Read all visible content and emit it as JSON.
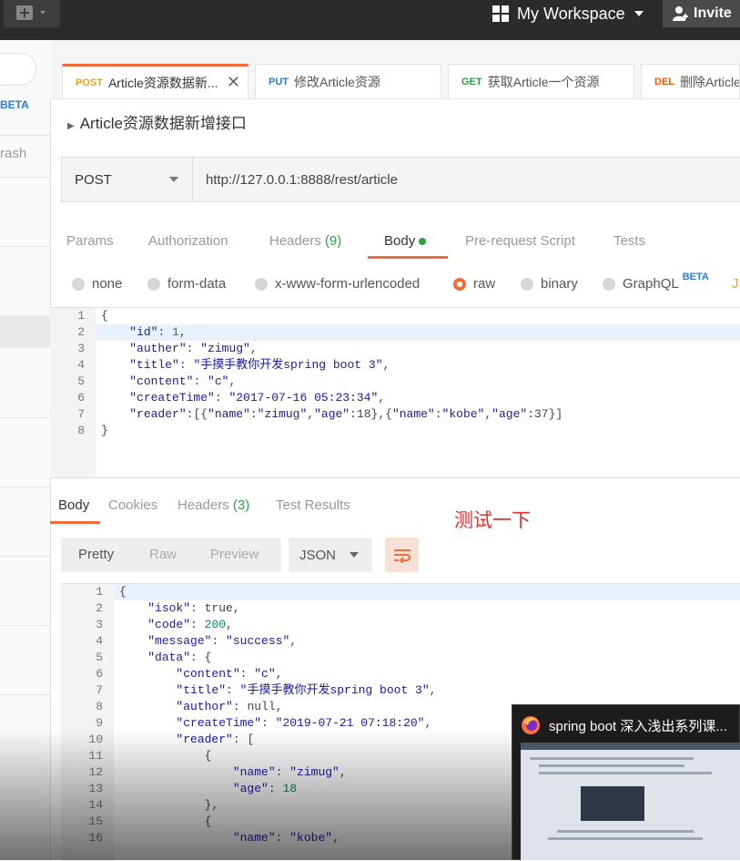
{
  "topbar": {
    "workspace": "My Workspace",
    "invite": "Invite"
  },
  "sidebar": {
    "beta": "BETA",
    "trash": "rash"
  },
  "tabs": [
    {
      "method": "POST",
      "label": "Article资源数据新...",
      "method_color": "#e8a417"
    },
    {
      "method": "PUT",
      "label": "修改Article资源",
      "method_color": "#2a7bd8"
    },
    {
      "method": "GET",
      "label": "获取Article一个资源",
      "method_color": "#2f9e44"
    },
    {
      "method": "DEL",
      "label": "删除Article",
      "method_color": "#e8590c"
    }
  ],
  "request": {
    "name": "Article资源数据新增接口",
    "method": "POST",
    "url": "http://127.0.0.1:8888/rest/article"
  },
  "request_tabs": {
    "params": "Params",
    "authorization": "Authorization",
    "headers": "Headers",
    "headers_count": "(9)",
    "body": "Body",
    "prerequest": "Pre-request Script",
    "tests": "Tests"
  },
  "body_types": {
    "none": "none",
    "form_data": "form-data",
    "urlencoded": "x-www-form-urlencoded",
    "raw": "raw",
    "binary": "binary",
    "graphql": "GraphQL",
    "graphql_beta": "BETA",
    "json": "JS"
  },
  "request_body": {
    "line_numbers": [
      "1",
      "2",
      "3",
      "4",
      "5",
      "6",
      "7",
      "8"
    ],
    "lines": [
      "{",
      "    \"id\": 1,",
      "    \"auther\": \"zimug\",",
      "    \"title\": \"手摸手教你开发spring boot 3\",",
      "    \"content\": \"c\",",
      "    \"createTime\": \"2017-07-16 05:23:34\",",
      "    \"reader\":[{\"name\":\"zimug\",\"age\":18},{\"name\":\"kobe\",\"age\":37}]",
      "}"
    ]
  },
  "response_tabs": {
    "body": "Body",
    "cookies": "Cookies",
    "headers": "Headers",
    "headers_count": "(3)",
    "test_results": "Test Results"
  },
  "annotation": "测试一下",
  "response_format": {
    "pretty": "Pretty",
    "raw": "Raw",
    "preview": "Preview",
    "json": "JSON"
  },
  "response_body": {
    "line_numbers": [
      "1",
      "2",
      "3",
      "4",
      "5",
      "6",
      "7",
      "8",
      "9",
      "10",
      "11",
      "12",
      "13",
      "14",
      "15",
      "16"
    ],
    "lines": [
      "{",
      "    \"isok\": true,",
      "    \"code\": 200,",
      "    \"message\": \"success\",",
      "    \"data\": {",
      "        \"content\": \"c\",",
      "        \"title\": \"手摸手教你开发spring boot 3\",",
      "        \"author\": null,",
      "        \"createTime\": \"2019-07-21 07:18:20\",",
      "        \"reader\": [",
      "            {",
      "                \"name\": \"zimug\",",
      "                \"age\": 18",
      "            },",
      "            {",
      "                \"name\": \"kobe\","
    ]
  },
  "video": {
    "title": "spring boot 深入浅出系列课..."
  }
}
